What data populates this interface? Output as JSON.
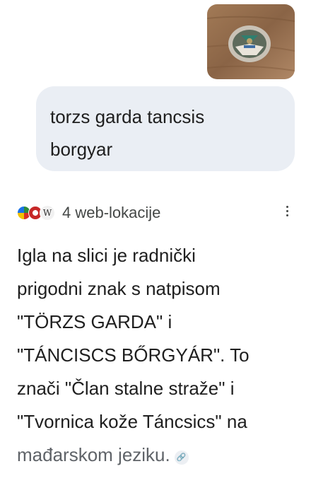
{
  "user_message": {
    "image_alt_name": "pin-photo",
    "lines": [
      "torzs garda tancsis",
      "borgyar"
    ]
  },
  "sources": {
    "label": "4 web-lokacije",
    "icons": [
      "site-favicon-icon",
      "site-favicon-icon",
      "wikipedia-icon"
    ],
    "wiki_glyph": "W"
  },
  "menu": {
    "icon": "more-vert-icon"
  },
  "answer": {
    "lines": [
      "Igla na slici je radnički",
      "prigodni znak s natpisom",
      "\"TÖRZS GARDA\" i",
      "\"TÁNCISCS BŐRGYÁR\". To",
      "znači \"Član stalne straže\" i",
      "\"Tvornica kože Táncsics\" na",
      "mađarskom jeziku."
    ],
    "link_icon": "link-icon",
    "link_glyph": "🔗"
  },
  "colors": {
    "bubble": "#eaeef4",
    "text": "#1f1f1f",
    "muted": "#444746"
  }
}
